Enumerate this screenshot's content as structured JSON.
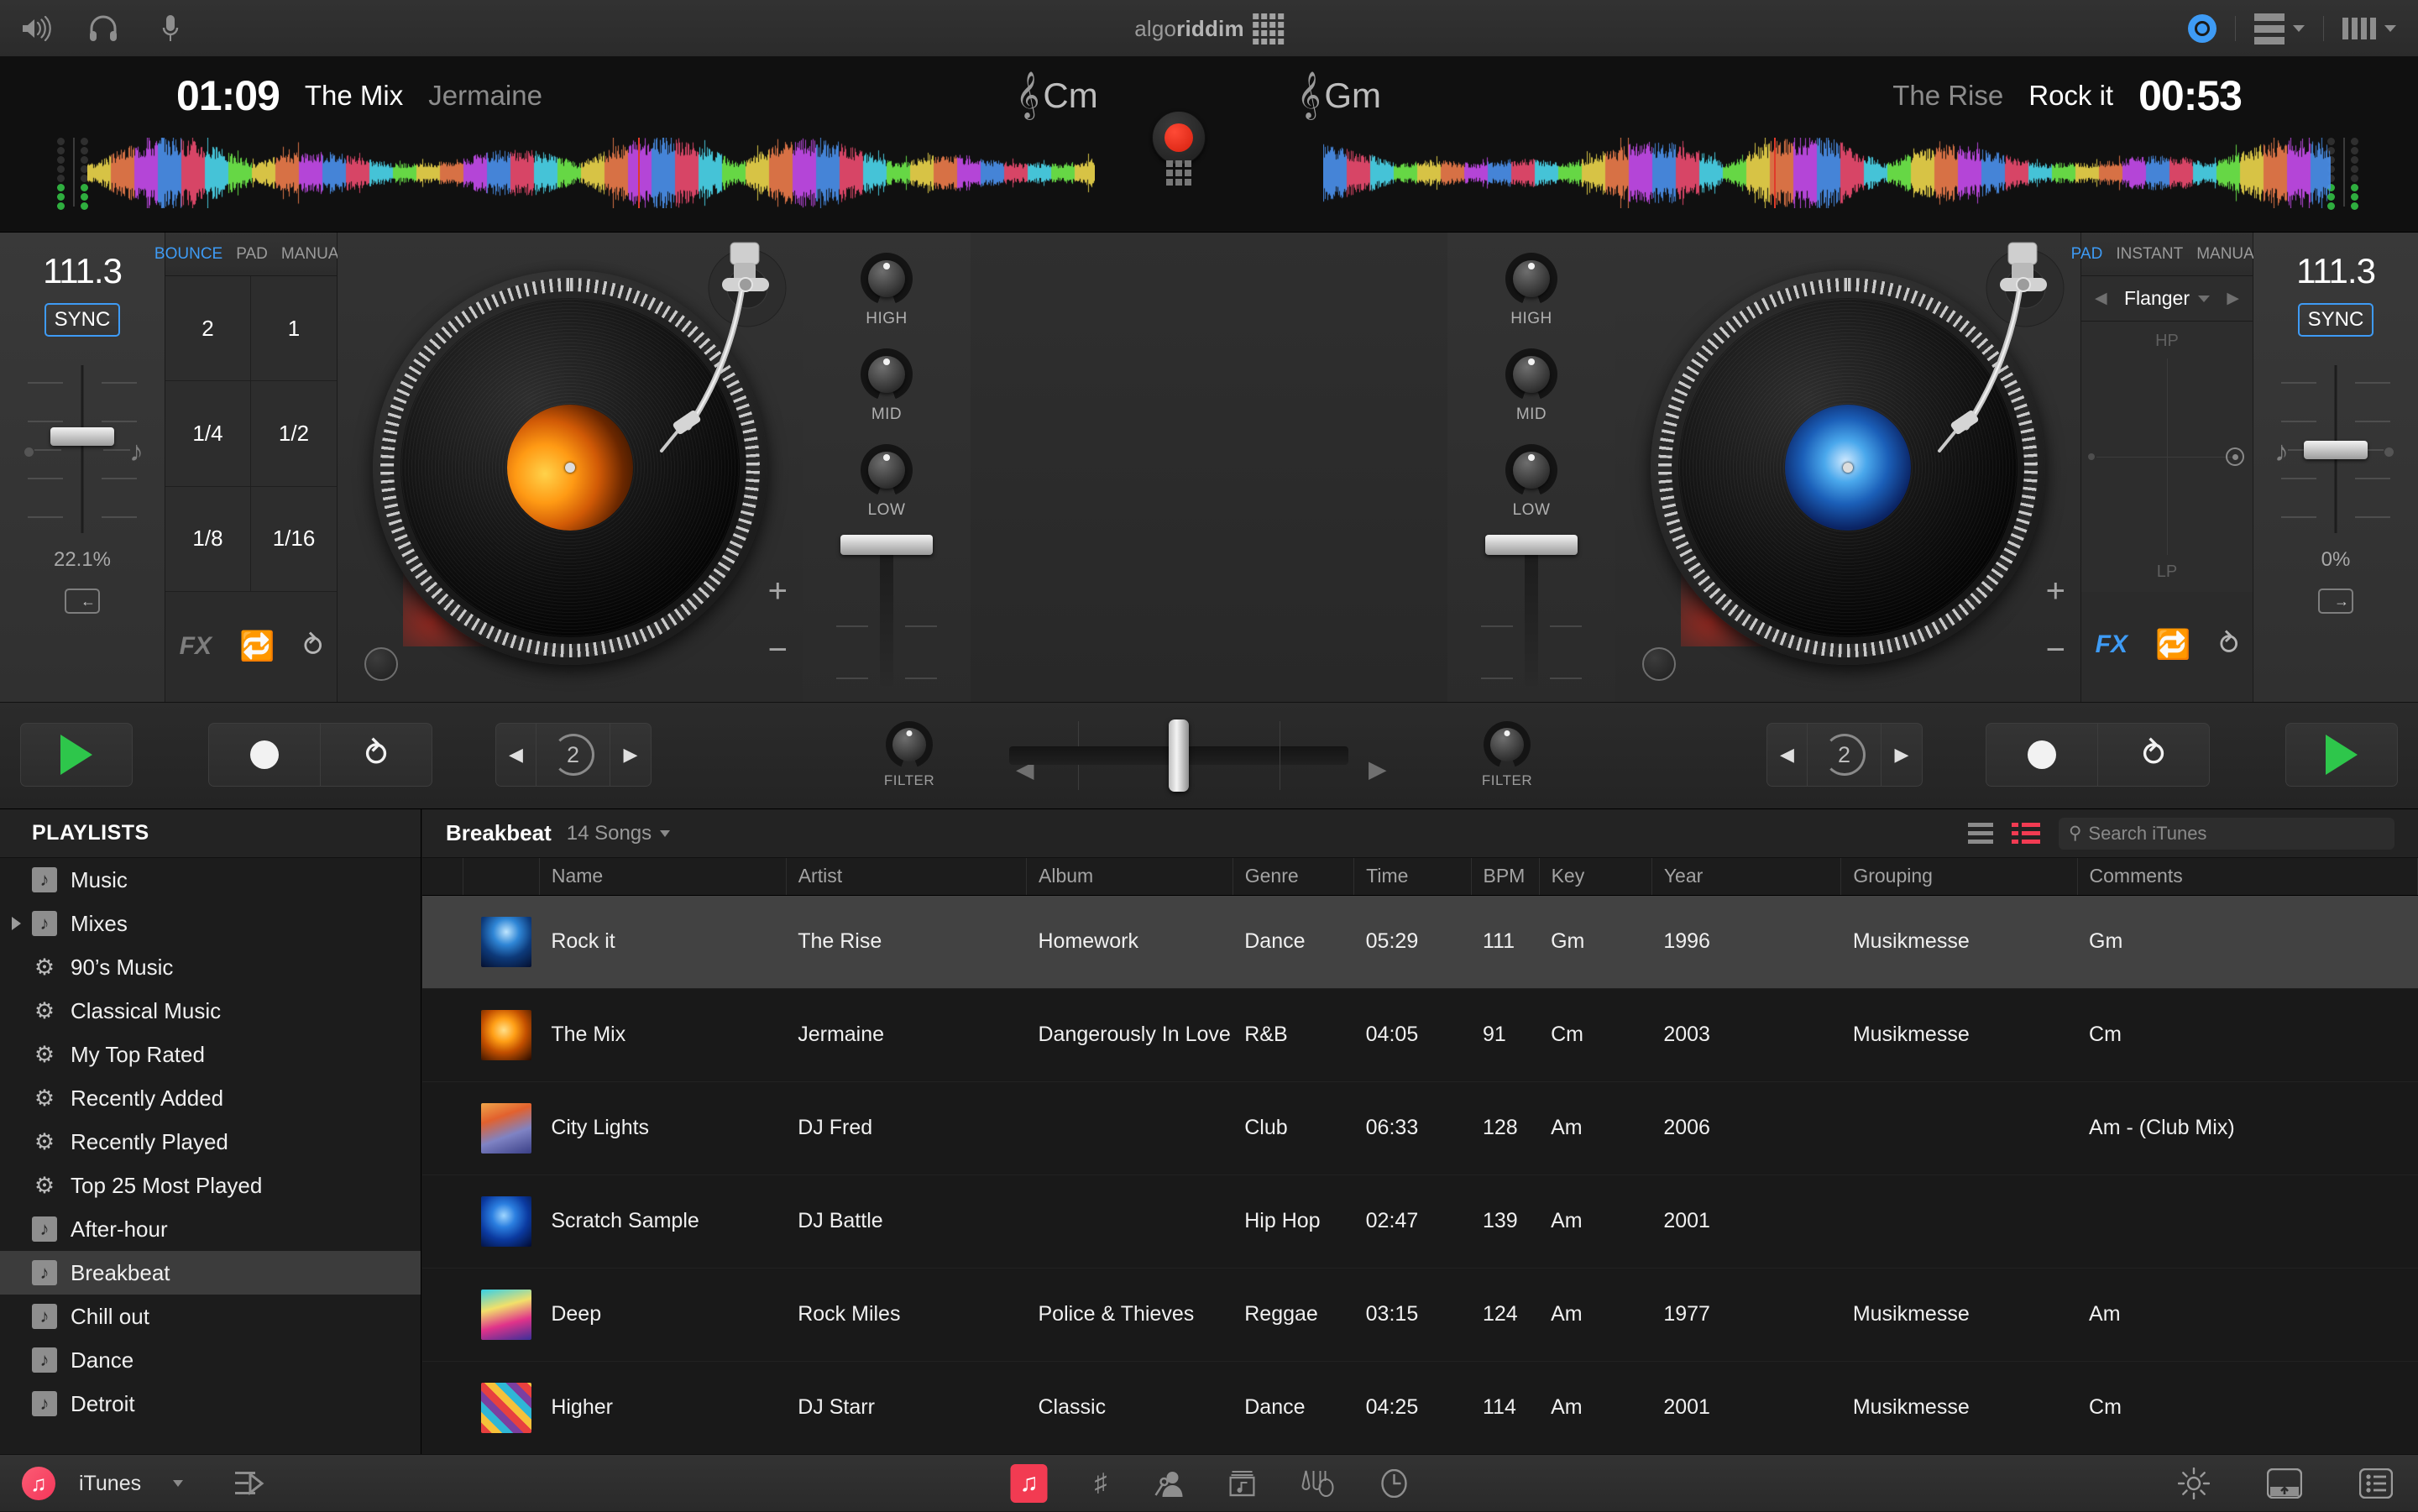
{
  "app": {
    "brand_light": "algo",
    "brand_bold": "riddim"
  },
  "menubar": {
    "icons": [
      "speaker-icon",
      "headphones-icon",
      "microphone-icon"
    ],
    "right_icons": [
      "disc-icon",
      "library-view-icon",
      "mixer-view-icon"
    ]
  },
  "decks": {
    "left": {
      "time": "01:09",
      "title": "The Mix",
      "artist": "Jermaine",
      "key": "Cm",
      "bpm": "111.3",
      "sync_label": "SYNC",
      "pitch_percent": "22.1%",
      "pad_tabs": [
        {
          "label": "BOUNCE",
          "active": true
        },
        {
          "label": "PAD",
          "active": false
        },
        {
          "label": "MANUAL",
          "active": false
        }
      ],
      "pad_cells": [
        "2",
        "1",
        "1/4",
        "1/2",
        "1/8",
        "1/16"
      ],
      "fx_label": "FX",
      "fx_active": false
    },
    "right": {
      "time": "00:53",
      "title": "Rock it",
      "artist": "The Rise",
      "key": "Gm",
      "bpm": "111.3",
      "sync_label": "SYNC",
      "pitch_percent": "0%",
      "pad_tabs": [
        {
          "label": "PAD",
          "active": true
        },
        {
          "label": "INSTANT",
          "active": false
        },
        {
          "label": "MANUAL",
          "active": false
        }
      ],
      "fx_name": "Flanger",
      "xy_top_label": "HP",
      "xy_bottom_label": "LP",
      "fx_label": "FX",
      "fx_active": true
    }
  },
  "eq": {
    "labels": [
      "HIGH",
      "MID",
      "LOW"
    ]
  },
  "transport": {
    "left": {
      "play_icon": "play-icon",
      "record_icon": "record-icon",
      "cue_icon": "cue-icon",
      "loop_value": "2"
    },
    "right": {
      "play_icon": "play-icon",
      "record_icon": "record-icon",
      "cue_icon": "cue-icon",
      "loop_value": "2"
    },
    "filter_label": "FILTER"
  },
  "library": {
    "sidebar_header": "PLAYLISTS",
    "items": [
      {
        "label": "Music",
        "icon": "playlist-icon",
        "selected": false,
        "expandable": false
      },
      {
        "label": "Mixes",
        "icon": "playlist-icon",
        "selected": false,
        "expandable": true
      },
      {
        "label": "90’s Music",
        "icon": "smart-playlist-icon",
        "selected": false,
        "expandable": false
      },
      {
        "label": "Classical Music",
        "icon": "smart-playlist-icon",
        "selected": false,
        "expandable": false
      },
      {
        "label": "My Top Rated",
        "icon": "smart-playlist-icon",
        "selected": false,
        "expandable": false
      },
      {
        "label": "Recently Added",
        "icon": "smart-playlist-icon",
        "selected": false,
        "expandable": false
      },
      {
        "label": "Recently Played",
        "icon": "smart-playlist-icon",
        "selected": false,
        "expandable": false
      },
      {
        "label": "Top 25 Most Played",
        "icon": "smart-playlist-icon",
        "selected": false,
        "expandable": false
      },
      {
        "label": "After-hour",
        "icon": "playlist-icon",
        "selected": false,
        "expandable": false
      },
      {
        "label": "Breakbeat",
        "icon": "playlist-icon",
        "selected": true,
        "expandable": false
      },
      {
        "label": "Chill out",
        "icon": "playlist-icon",
        "selected": false,
        "expandable": false
      },
      {
        "label": "Dance",
        "icon": "playlist-icon",
        "selected": false,
        "expandable": false
      },
      {
        "label": "Detroit",
        "icon": "playlist-icon",
        "selected": false,
        "expandable": false
      }
    ],
    "playlist_title": "Breakbeat",
    "song_count": "14 Songs",
    "search_placeholder": "Search iTunes",
    "search_value": "",
    "columns": [
      "",
      "",
      "Name",
      "Artist",
      "Album",
      "Genre",
      "Time",
      "BPM",
      "Key",
      "Year",
      "Grouping",
      "Comments"
    ],
    "rows": [
      {
        "name": "Rock it",
        "artist": "The Rise",
        "album": "Homework",
        "genre": "Dance",
        "time": "05:29",
        "bpm": "111",
        "key": "Gm",
        "year": "1996",
        "grouping": "Musikmesse",
        "comments": "Gm",
        "selected": true,
        "art": "art-rock-it"
      },
      {
        "name": "The Mix",
        "artist": "Jermaine",
        "album": "Dangerously In Love",
        "genre": "R&B",
        "time": "04:05",
        "bpm": "91",
        "key": "Cm",
        "year": "2003",
        "grouping": "Musikmesse",
        "comments": "Cm",
        "selected": false,
        "art": "art-the-mix"
      },
      {
        "name": "City Lights",
        "artist": "DJ Fred",
        "album": "",
        "genre": "Club",
        "time": "06:33",
        "bpm": "128",
        "key": "Am",
        "year": "2006",
        "grouping": "",
        "comments": "Am - (Club Mix)",
        "selected": false,
        "art": "art-city-lights"
      },
      {
        "name": "Scratch Sample",
        "artist": "DJ Battle",
        "album": "",
        "genre": "Hip Hop",
        "time": "02:47",
        "bpm": "139",
        "key": "Am",
        "year": "2001",
        "grouping": "",
        "comments": "",
        "selected": false,
        "art": "art-scratch"
      },
      {
        "name": "Deep",
        "artist": "Rock Miles",
        "album": "Police & Thieves",
        "genre": "Reggae",
        "time": "03:15",
        "bpm": "124",
        "key": "Am",
        "year": "1977",
        "grouping": "Musikmesse",
        "comments": "Am",
        "selected": false,
        "art": "art-deep"
      },
      {
        "name": "Higher",
        "artist": "DJ Starr",
        "album": "Classic",
        "genre": "Dance",
        "time": "04:25",
        "bpm": "114",
        "key": "Am",
        "year": "2001",
        "grouping": "Musikmesse",
        "comments": "Cm",
        "selected": false,
        "art": "art-higher"
      }
    ]
  },
  "bottombar": {
    "source_label": "iTunes",
    "center_icons": [
      "library-active-icon",
      "songs-icon",
      "artists-icon",
      "albums-icon",
      "genres-icon",
      "history-icon"
    ],
    "right_icons": [
      "brightness-icon",
      "panel-toggle-icon",
      "list-view-icon"
    ]
  },
  "colors": {
    "accent_blue": "#3e9bf5",
    "accent_red": "#f23b52",
    "record_red": "#e8321c",
    "play_green": "#2ec64b",
    "bg_dark": "#191919"
  }
}
